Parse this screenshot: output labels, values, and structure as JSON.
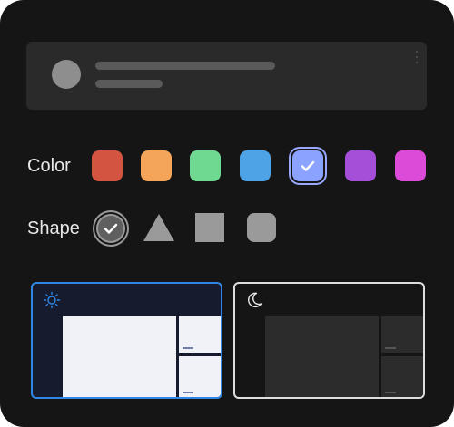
{
  "labels": {
    "color": "Color",
    "shape": "Shape"
  },
  "colors": [
    {
      "name": "red",
      "hex": "#d35440",
      "selected": false
    },
    {
      "name": "orange",
      "hex": "#f4a55a",
      "selected": false
    },
    {
      "name": "green",
      "hex": "#6fd992",
      "selected": false
    },
    {
      "name": "blue",
      "hex": "#4da3e6",
      "selected": false
    },
    {
      "name": "periwinkle",
      "hex": "#8ca2ff",
      "selected": true
    },
    {
      "name": "purple",
      "hex": "#a54fd8",
      "selected": false
    },
    {
      "name": "magenta",
      "hex": "#db4bd8",
      "selected": false
    }
  ],
  "shapes": [
    {
      "name": "circle",
      "selected": true
    },
    {
      "name": "triangle",
      "selected": false
    },
    {
      "name": "square",
      "selected": false
    },
    {
      "name": "rounded-square",
      "selected": false
    }
  ],
  "themes": [
    {
      "name": "light",
      "icon": "sun-icon",
      "selected": true,
      "accent": "#2f86e6"
    },
    {
      "name": "dark",
      "icon": "moon-icon",
      "selected": false,
      "accent": "#dedede"
    }
  ]
}
